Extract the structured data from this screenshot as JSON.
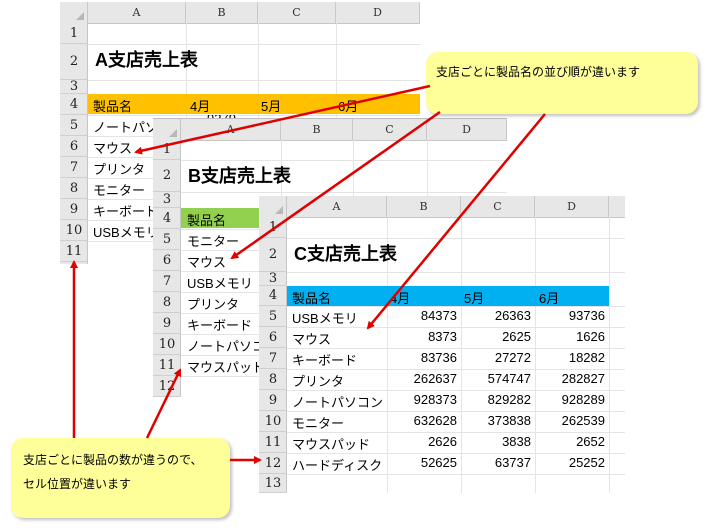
{
  "columns": [
    "A",
    "B",
    "C",
    "D"
  ],
  "sheetA": {
    "title": "A支店売上表",
    "header": [
      "製品名",
      "4月",
      "5月",
      "6月"
    ],
    "products": [
      "ノートパソコン",
      "マウス",
      "プリンタ",
      "モニター",
      "キーボード",
      "USBメモリ"
    ],
    "visible_fragment": "9279",
    "header_color": "#ffc000"
  },
  "sheetB": {
    "title": "B支店売上表",
    "header": [
      "製品名"
    ],
    "products": [
      "モニター",
      "マウス",
      "USBメモリ",
      "プリンタ",
      "キーボード",
      "ノートパソコン",
      "マウスパッド"
    ],
    "header_color": "#92d050"
  },
  "sheetC": {
    "title": "C支店売上表",
    "header": [
      "製品名",
      "4月",
      "5月",
      "6月"
    ],
    "rows": [
      [
        "USBメモリ",
        "84373",
        "26363",
        "93736"
      ],
      [
        "マウス",
        "8373",
        "2625",
        "1626"
      ],
      [
        "キーボード",
        "83736",
        "27272",
        "18282"
      ],
      [
        "プリンタ",
        "262637",
        "574747",
        "282827"
      ],
      [
        "ノートパソコン",
        "928373",
        "829282",
        "928289"
      ],
      [
        "モニター",
        "632628",
        "373838",
        "262539"
      ],
      [
        "マウスパッド",
        "2626",
        "3838",
        "2652"
      ],
      [
        "ハードディスク",
        "52625",
        "63737",
        "25252"
      ]
    ],
    "header_color": "#00b0f0"
  },
  "callout_top": "支店ごとに製品名の並び順が違います",
  "callout_bottom_line1": "支店ごとに製品の数が違うので、",
  "callout_bottom_line2": "セル位置が違います"
}
